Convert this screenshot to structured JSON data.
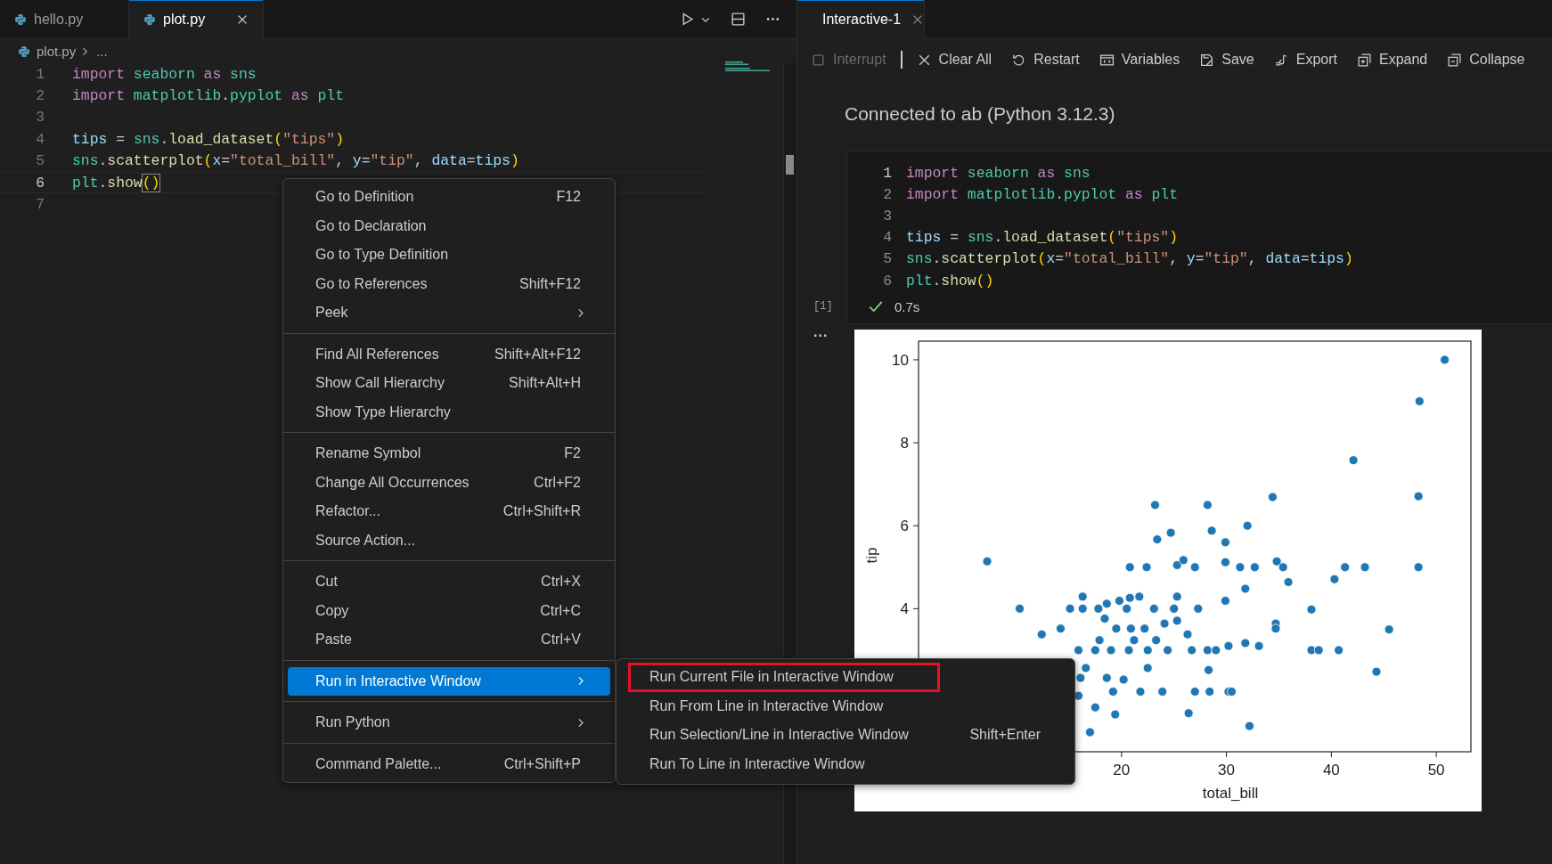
{
  "editor": {
    "tabs": [
      {
        "label": "hello.py",
        "selected": false
      },
      {
        "label": "plot.py",
        "selected": true
      }
    ],
    "breadcrumb": {
      "file": "plot.py",
      "rest": "..."
    },
    "lines": [
      {
        "number": "1",
        "current": false,
        "tokens": [
          {
            "kind": "kw",
            "text": "import"
          },
          {
            "kind": "mod",
            "text": " seaborn"
          },
          {
            "kind": "kw",
            "text": " as"
          },
          {
            "kind": "mod",
            "text": " sns"
          }
        ]
      },
      {
        "number": "2",
        "current": false,
        "tokens": [
          {
            "kind": "kw",
            "text": "import"
          },
          {
            "kind": "mod",
            "text": " matplotlib"
          },
          {
            "kind": "plain",
            "text": "."
          },
          {
            "kind": "mod",
            "text": "pyplot"
          },
          {
            "kind": "kw",
            "text": " as"
          },
          {
            "kind": "mod",
            "text": " plt"
          }
        ]
      },
      {
        "number": "3",
        "current": false
      },
      {
        "number": "4",
        "current": false,
        "tokens": [
          {
            "kind": "var",
            "text": "tips"
          },
          {
            "kind": "plain",
            "text": " = "
          },
          {
            "kind": "mod",
            "text": "sns"
          },
          {
            "kind": "plain",
            "text": "."
          },
          {
            "kind": "fn",
            "text": "load_dataset"
          },
          {
            "kind": "br",
            "text": "("
          },
          {
            "kind": "str",
            "text": "\"tips\""
          },
          {
            "kind": "br",
            "text": ")"
          }
        ]
      },
      {
        "number": "5",
        "current": false,
        "tokens": [
          {
            "kind": "mod",
            "text": "sns"
          },
          {
            "kind": "plain",
            "text": "."
          },
          {
            "kind": "fn",
            "text": "scatterplot"
          },
          {
            "kind": "br",
            "text": "("
          },
          {
            "kind": "var",
            "text": "x"
          },
          {
            "kind": "plain",
            "text": "="
          },
          {
            "kind": "str",
            "text": "\"total_bill\""
          },
          {
            "kind": "plain",
            "text": ", "
          },
          {
            "kind": "var",
            "text": "y"
          },
          {
            "kind": "plain",
            "text": "="
          },
          {
            "kind": "str",
            "text": "\"tip\""
          },
          {
            "kind": "plain",
            "text": ", "
          },
          {
            "kind": "var",
            "text": "data"
          },
          {
            "kind": "plain",
            "text": "="
          },
          {
            "kind": "var",
            "text": "tips"
          },
          {
            "kind": "br",
            "text": ")"
          }
        ]
      },
      {
        "number": "6",
        "current": true,
        "tokens": [
          {
            "kind": "mod",
            "text": "plt"
          },
          {
            "kind": "plain",
            "text": "."
          },
          {
            "kind": "fn",
            "text": "show"
          },
          {
            "kind": "br",
            "text": "()",
            "boxed": true
          }
        ]
      },
      {
        "number": "7",
        "current": false
      }
    ]
  },
  "context_menu": {
    "groups": [
      [
        {
          "label": "Go to Definition",
          "shortcut": "F12",
          "submenu": false,
          "selected": false
        },
        {
          "label": "Go to Declaration",
          "submenu": false,
          "selected": false
        },
        {
          "label": "Go to Type Definition",
          "submenu": false,
          "selected": false
        },
        {
          "label": "Go to References",
          "shortcut": "Shift+F12",
          "submenu": false,
          "selected": false
        },
        {
          "label": "Peek",
          "submenu": true,
          "selected": false
        }
      ],
      [
        {
          "label": "Find All References",
          "shortcut": "Shift+Alt+F12",
          "submenu": false,
          "selected": false
        },
        {
          "label": "Show Call Hierarchy",
          "shortcut": "Shift+Alt+H",
          "submenu": false,
          "selected": false
        },
        {
          "label": "Show Type Hierarchy",
          "submenu": false,
          "selected": false
        }
      ],
      [
        {
          "label": "Rename Symbol",
          "shortcut": "F2",
          "submenu": false,
          "selected": false
        },
        {
          "label": "Change All Occurrences",
          "shortcut": "Ctrl+F2",
          "submenu": false,
          "selected": false
        },
        {
          "label": "Refactor...",
          "shortcut": "Ctrl+Shift+R",
          "submenu": false,
          "selected": false
        },
        {
          "label": "Source Action...",
          "submenu": false,
          "selected": false
        }
      ],
      [
        {
          "label": "Cut",
          "shortcut": "Ctrl+X",
          "submenu": false,
          "selected": false
        },
        {
          "label": "Copy",
          "shortcut": "Ctrl+C",
          "submenu": false,
          "selected": false
        },
        {
          "label": "Paste",
          "shortcut": "Ctrl+V",
          "submenu": false,
          "selected": false
        }
      ],
      [
        {
          "label": "Run in Interactive Window",
          "submenu": true,
          "selected": true
        }
      ],
      [
        {
          "label": "Run Python",
          "submenu": true,
          "selected": false
        }
      ],
      [
        {
          "label": "Command Palette...",
          "shortcut": "Ctrl+Shift+P",
          "submenu": false,
          "selected": false
        }
      ]
    ]
  },
  "submenu": {
    "items": [
      {
        "label": "Run Current File in Interactive Window",
        "outlined": true
      },
      {
        "label": "Run From Line in Interactive Window",
        "outlined": false
      },
      {
        "label": "Run Selection/Line in Interactive Window",
        "shortcut": "Shift+Enter",
        "outlined": false
      },
      {
        "label": "Run To Line in Interactive Window",
        "outlined": false
      }
    ]
  },
  "interactive": {
    "tab": {
      "label": "Interactive-1"
    },
    "toolbar": [
      {
        "label": "Interrupt",
        "disabled": true
      },
      {
        "label": "Clear All",
        "disabled": false
      },
      {
        "label": "Restart",
        "disabled": false
      },
      {
        "label": "Variables",
        "disabled": false
      },
      {
        "label": "Save",
        "disabled": false
      },
      {
        "label": "Export",
        "disabled": false
      },
      {
        "label": "Expand",
        "disabled": false
      },
      {
        "label": "Collapse",
        "disabled": false
      }
    ],
    "status": "Connected to ab (Python 3.12.3)",
    "cell": {
      "execution_count": "[1]",
      "duration": "0.7s",
      "succeeded": true,
      "lines": [
        {
          "number": "1",
          "tokens": [
            {
              "kind": "kw",
              "text": "import"
            },
            {
              "kind": "mod",
              "text": " seaborn"
            },
            {
              "kind": "kw",
              "text": " as"
            },
            {
              "kind": "mod",
              "text": " sns"
            }
          ]
        },
        {
          "number": "2",
          "tokens": [
            {
              "kind": "kw",
              "text": "import"
            },
            {
              "kind": "mod",
              "text": " matplotlib"
            },
            {
              "kind": "plain",
              "text": "."
            },
            {
              "kind": "mod",
              "text": "pyplot"
            },
            {
              "kind": "kw",
              "text": " as"
            },
            {
              "kind": "mod",
              "text": " plt"
            }
          ]
        },
        {
          "number": "3"
        },
        {
          "number": "4",
          "tokens": [
            {
              "kind": "var",
              "text": "tips"
            },
            {
              "kind": "plain",
              "text": " = "
            },
            {
              "kind": "mod",
              "text": "sns"
            },
            {
              "kind": "plain",
              "text": "."
            },
            {
              "kind": "fn",
              "text": "load_dataset"
            },
            {
              "kind": "br",
              "text": "("
            },
            {
              "kind": "str",
              "text": "\"tips\""
            },
            {
              "kind": "br",
              "text": ")"
            }
          ]
        },
        {
          "number": "5",
          "tokens": [
            {
              "kind": "mod",
              "text": "sns"
            },
            {
              "kind": "plain",
              "text": "."
            },
            {
              "kind": "fn",
              "text": "scatterplot"
            },
            {
              "kind": "br",
              "text": "("
            },
            {
              "kind": "var",
              "text": "x"
            },
            {
              "kind": "plain",
              "text": "="
            },
            {
              "kind": "str",
              "text": "\"total_bill\""
            },
            {
              "kind": "plain",
              "text": ", "
            },
            {
              "kind": "var",
              "text": "y"
            },
            {
              "kind": "plain",
              "text": "="
            },
            {
              "kind": "str",
              "text": "\"tip\""
            },
            {
              "kind": "plain",
              "text": ", "
            },
            {
              "kind": "var",
              "text": "data"
            },
            {
              "kind": "plain",
              "text": "="
            },
            {
              "kind": "var",
              "text": "tips"
            },
            {
              "kind": "br",
              "text": ")"
            }
          ]
        },
        {
          "number": "6",
          "tokens": [
            {
              "kind": "mod",
              "text": "plt"
            },
            {
              "kind": "plain",
              "text": "."
            },
            {
              "kind": "fn",
              "text": "show"
            },
            {
              "kind": "br",
              "text": "()"
            }
          ]
        }
      ]
    },
    "output_more": "...",
    "chart_data": {
      "type": "scatter",
      "xlabel": "total_bill",
      "ylabel": "tip",
      "xlim": [
        0.66,
        53.3
      ],
      "ylim": [
        0.55,
        10.45
      ],
      "xticks": [
        20,
        30,
        40,
        50
      ],
      "yticks": [
        4,
        6,
        8,
        10
      ],
      "series": [
        {
          "color": "#1f77b4",
          "x": [
            50.8,
            48.4,
            42.1,
            48.3,
            34.4,
            23.2,
            28.2,
            23.4,
            24.7,
            28.6,
            29.9,
            32.0,
            25.3,
            25.9,
            27.0,
            20.8,
            22.4,
            29.9,
            31.3,
            32.7,
            34.8,
            35.4,
            35.9,
            31.8,
            40.3,
            41.3,
            43.2,
            48.3,
            29.9,
            25.3,
            38.1,
            34.7,
            34.7,
            45.5,
            38.1,
            38.8,
            40.7,
            44.3,
            32.2,
            17.0,
            7.2,
            10.3,
            12.4,
            15.1,
            14.2,
            16.3,
            16.3,
            17.8,
            18.6,
            19.8,
            20.8,
            21.7,
            20.5,
            23.1,
            25.0,
            27.3,
            18.4,
            19.5,
            20.9,
            22.2,
            24.1,
            25.3,
            26.3,
            28.2,
            29.0,
            30.2,
            31.8,
            33.1,
            26.7,
            23.3,
            21.2,
            17.9,
            15.9,
            17.5,
            19.0,
            20.7,
            22.5,
            24.4,
            16.6,
            18.6,
            20.2,
            22.5,
            23.9,
            28.3,
            28.4,
            27.0,
            30.2,
            30.5,
            26.4,
            21.8,
            19.2,
            15.9,
            17.5,
            19.4,
            16.1
          ],
          "values": [
            10.0,
            9.0,
            7.58,
            6.71,
            6.69,
            6.5,
            6.5,
            5.67,
            5.83,
            5.88,
            5.6,
            6.0,
            5.05,
            5.17,
            5.0,
            5.0,
            5.0,
            5.12,
            5.0,
            5.0,
            5.14,
            5.0,
            4.64,
            4.48,
            4.71,
            5.0,
            5.0,
            5.0,
            4.19,
            4.29,
            3.98,
            3.64,
            3.52,
            3.5,
            3.0,
            3.0,
            3.0,
            2.48,
            1.17,
            1.02,
            5.14,
            4.0,
            3.38,
            4.0,
            3.52,
            4.29,
            4.0,
            4.0,
            4.12,
            4.19,
            4.26,
            4.29,
            4.0,
            4.0,
            4.0,
            4.0,
            3.76,
            3.52,
            3.52,
            3.52,
            3.64,
            3.71,
            3.38,
            3.0,
            3.0,
            3.1,
            3.17,
            3.1,
            3.0,
            3.24,
            3.24,
            3.24,
            3.0,
            3.0,
            3.0,
            3.0,
            3.0,
            3.0,
            2.57,
            2.33,
            2.29,
            2.57,
            2.0,
            2.52,
            2.0,
            2.0,
            2.0,
            2.0,
            1.48,
            2.0,
            2.0,
            1.9,
            1.62,
            1.45,
            2.33
          ]
        }
      ]
    }
  }
}
